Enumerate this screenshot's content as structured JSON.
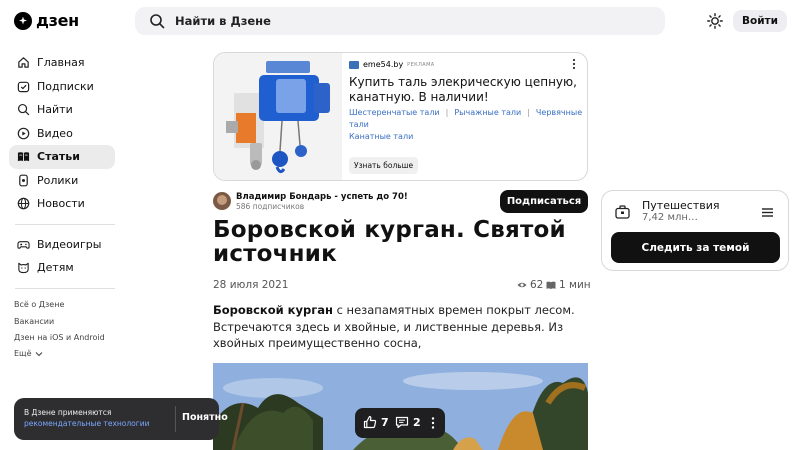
{
  "header": {
    "logo_text": "дзен",
    "search_placeholder": "Найти в Дзене",
    "login_label": "Войти"
  },
  "sidebar": {
    "items": [
      {
        "label": "Главная",
        "icon": "home-icon"
      },
      {
        "label": "Подписки",
        "icon": "subscriptions-icon"
      },
      {
        "label": "Найти",
        "icon": "search-icon"
      },
      {
        "label": "Видео",
        "icon": "video-icon"
      },
      {
        "label": "Статьи",
        "icon": "articles-icon",
        "active": true
      },
      {
        "label": "Ролики",
        "icon": "shorts-icon"
      },
      {
        "label": "Новости",
        "icon": "news-icon"
      }
    ],
    "items2": [
      {
        "label": "Видеоигры",
        "icon": "gamepad-icon"
      },
      {
        "label": "Детям",
        "icon": "kids-icon"
      }
    ],
    "links": [
      "Всё о Дзене",
      "Вакансии",
      "Дзен на iOS и Android",
      "Ещё"
    ]
  },
  "ad": {
    "source": "eme54.by",
    "tag": "Реклама",
    "title": "Купить таль элекрическую цепную, канатную. В наличии!",
    "links": [
      "Шестеренчатые тали",
      "Рычажные тали",
      "Червячные тали",
      "Канатные тали"
    ],
    "button": "Узнать больше"
  },
  "article": {
    "author_name": "Владимир Бондарь - успеть до 70!",
    "author_subs": "586 подписчиков",
    "subscribe_label": "Подписаться",
    "title": "Боровской курган. Святой источник",
    "date": "28 июля 2021",
    "views": "62",
    "read_time": "1 мин",
    "body_bold": "Боровской курган",
    "body_rest": " с незапамятных времен покрыт лесом. Встречаются здесь и хвойные, и лиственные деревья. Из хвойных преимущественно сосна,"
  },
  "topic": {
    "name": "Путешествия",
    "count": "7,42 млн…",
    "button": "Следить за темой"
  },
  "toast": {
    "text": "В Дзене применяются",
    "link": "рекомендательные технологии",
    "button": "Понятно"
  },
  "reactions": {
    "likes": "7",
    "comments": "2"
  },
  "colors": {
    "accent_dark": "#111111",
    "link_blue": "#3a6fc2",
    "search_bg": "#f2f2f5"
  }
}
